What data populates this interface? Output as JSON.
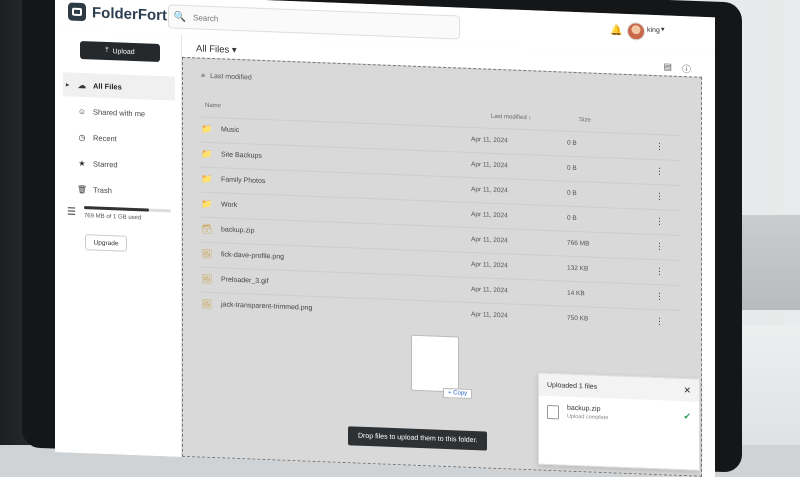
{
  "app": {
    "brand": "FolderFort"
  },
  "search": {
    "placeholder": "Search"
  },
  "user": {
    "name": "king"
  },
  "sidebar": {
    "upload_label": "Upload",
    "items": [
      {
        "label": "All Files",
        "icon": "cloud-icon"
      },
      {
        "label": "Shared with me",
        "icon": "people-icon"
      },
      {
        "label": "Recent",
        "icon": "clock-icon"
      },
      {
        "label": "Starred",
        "icon": "star-icon"
      },
      {
        "label": "Trash",
        "icon": "trash-icon"
      }
    ],
    "storage": {
      "used_text": "769 MB of 1 GB used",
      "used_fraction": 0.75
    },
    "upgrade_label": "Upgrade"
  },
  "main": {
    "title": "All Files",
    "sort_label": "Last modified",
    "columns": {
      "name": "Name",
      "modified": "Last modified",
      "size": "Size"
    },
    "files": [
      {
        "name": "Music",
        "type": "folder",
        "modified": "Apr 11, 2024",
        "size": "0 B"
      },
      {
        "name": "Site Backups",
        "type": "folder",
        "modified": "Apr 11, 2024",
        "size": "0 B"
      },
      {
        "name": "Family Photos",
        "type": "folder",
        "modified": "Apr 11, 2024",
        "size": "0 B"
      },
      {
        "name": "Work",
        "type": "folder",
        "modified": "Apr 11, 2024",
        "size": "0 B"
      },
      {
        "name": "backup.zip",
        "type": "zip",
        "modified": "Apr 11, 2024",
        "size": "766 MB"
      },
      {
        "name": "fick-dave-profile.png",
        "type": "image",
        "modified": "Apr 11, 2024",
        "size": "132 KB"
      },
      {
        "name": "Preloader_3.gif",
        "type": "image",
        "modified": "Apr 11, 2024",
        "size": "14 KB"
      },
      {
        "name": "jack-transparent-trimmed.png",
        "type": "image",
        "modified": "Apr 11, 2024",
        "size": "750 KB"
      }
    ],
    "copy_badge": "+ Copy",
    "drop_hint": "Drop files to upload them to this folder."
  },
  "upload_panel": {
    "title": "Uploaded 1 files",
    "item_name": "backup.zip",
    "item_status": "Upload complete"
  }
}
